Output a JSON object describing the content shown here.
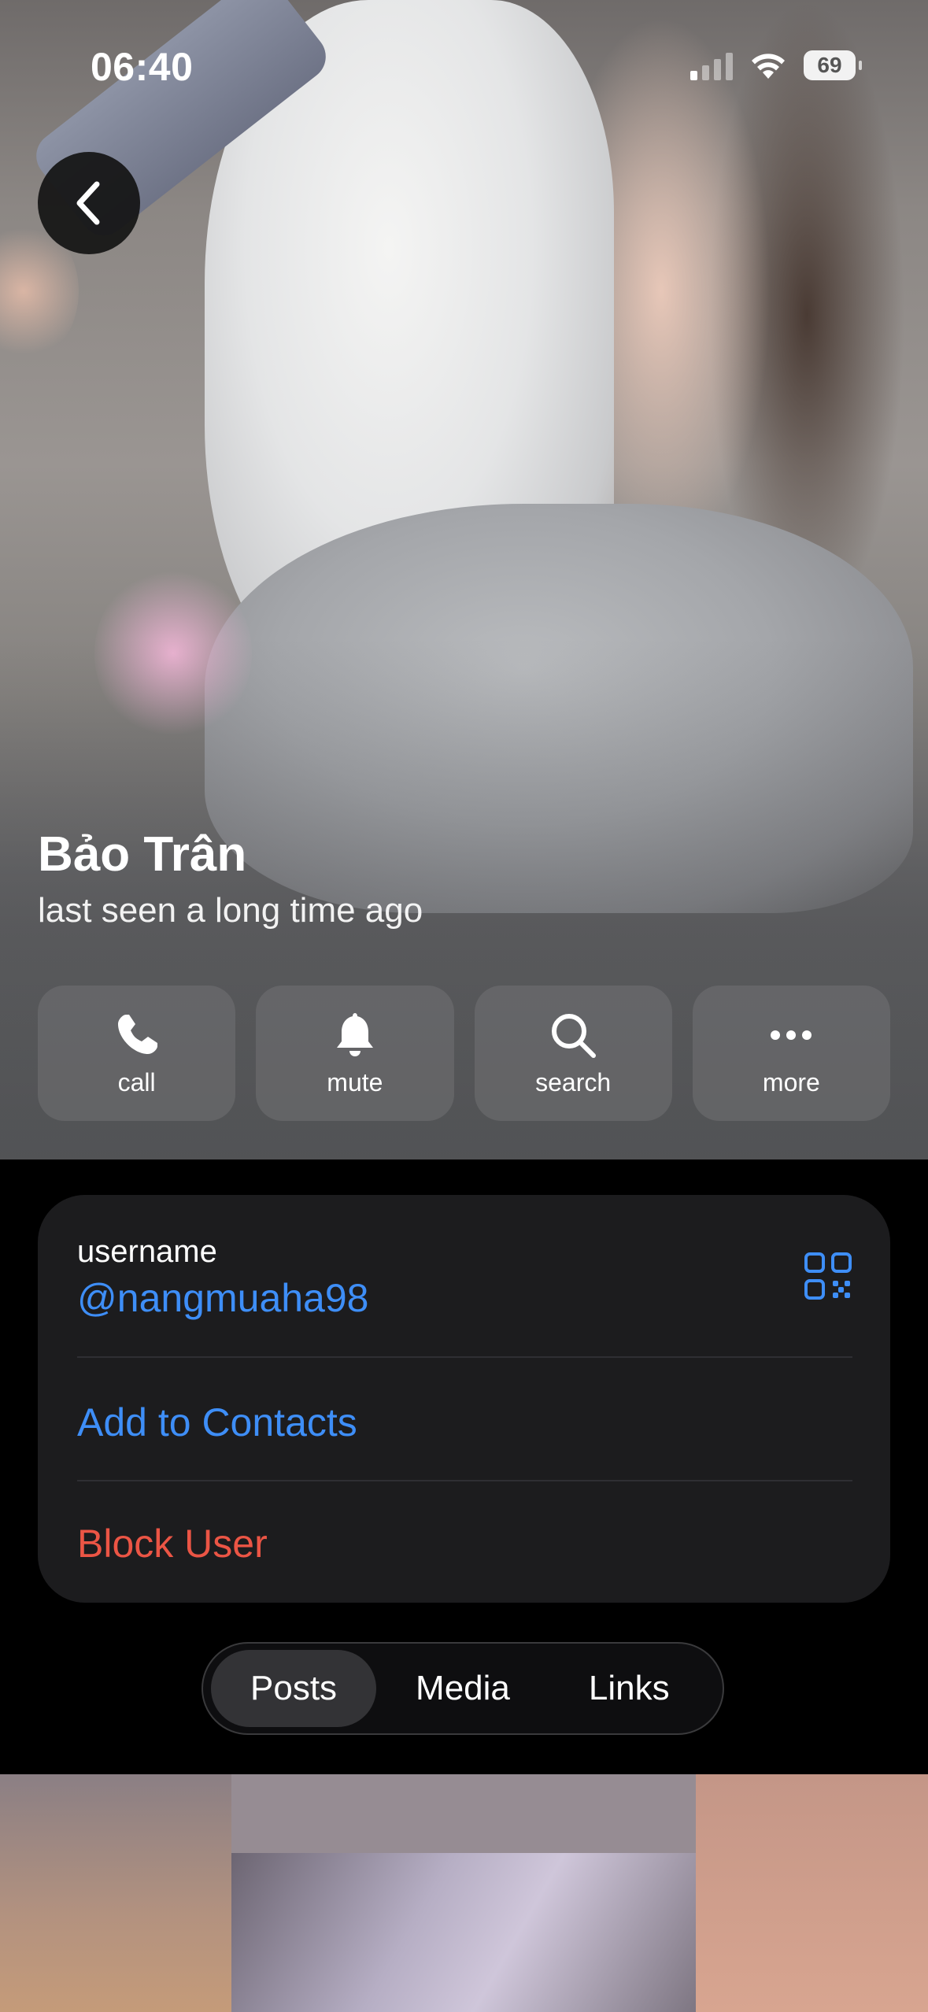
{
  "status_bar": {
    "time": "06:40",
    "battery": "69"
  },
  "profile": {
    "name": "Bảo Trân",
    "status": "last seen a long time ago"
  },
  "actions": [
    {
      "label": "call",
      "icon": "phone-icon"
    },
    {
      "label": "mute",
      "icon": "bell-icon"
    },
    {
      "label": "search",
      "icon": "search-icon"
    },
    {
      "label": "more",
      "icon": "more-icon"
    }
  ],
  "info": {
    "username_label": "username",
    "username_value": "@nangmuaha98",
    "add_contact": "Add to Contacts",
    "block_user": "Block User"
  },
  "tabs": [
    {
      "label": "Posts",
      "active": true
    },
    {
      "label": "Media",
      "active": false
    },
    {
      "label": "Links",
      "active": false
    }
  ],
  "colors": {
    "accent": "#3e8ef7",
    "danger": "#eb5545",
    "card": "#1c1c1e"
  }
}
